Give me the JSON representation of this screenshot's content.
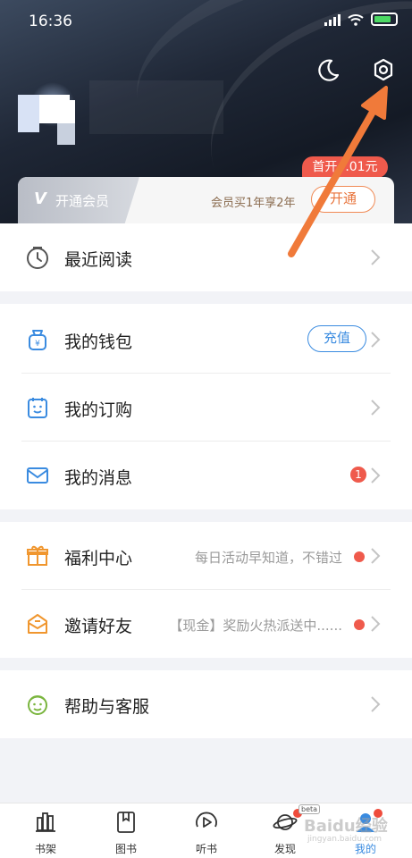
{
  "status_bar": {
    "time": "16:36"
  },
  "vip": {
    "label": "开通会员",
    "description": "会员买1年享2年",
    "button": "开通",
    "promo": "首开",
    "promo_tail": ".01元"
  },
  "menu": {
    "recent": {
      "label": "最近阅读",
      "icon": "clock-icon"
    },
    "wallet": {
      "label": "我的钱包",
      "chip": "充值",
      "icon": "wallet-icon"
    },
    "orders": {
      "label": "我的订购",
      "icon": "calendar-smile-icon"
    },
    "messages": {
      "label": "我的消息",
      "badge": "1",
      "icon": "mail-icon"
    },
    "welfare": {
      "label": "福利中心",
      "note": "每日活动早知道，不错过",
      "icon": "gift-icon"
    },
    "invite": {
      "label": "邀请好友",
      "note": "【现金】奖励火热派送中......",
      "icon": "envelope-icon"
    },
    "help": {
      "label": "帮助与客服",
      "icon": "support-icon"
    }
  },
  "tabs": [
    {
      "label": "书架",
      "icon": "bookshelf-icon"
    },
    {
      "label": "图书",
      "icon": "book-icon"
    },
    {
      "label": "听书",
      "icon": "play-icon"
    },
    {
      "label": "发现",
      "icon": "planet-icon"
    },
    {
      "label": "我的",
      "icon": "profile-icon"
    }
  ],
  "beta_tag": "beta",
  "watermark": {
    "text": "Baidu经验",
    "url": "jingyan.baidu.com"
  },
  "colors": {
    "accent": "#3a8be0",
    "red": "#ef5a4c",
    "arrow": "#f07a3a"
  }
}
